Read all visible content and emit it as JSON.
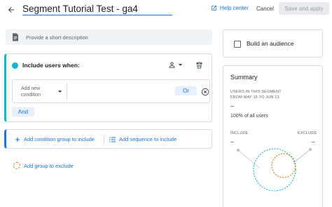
{
  "header": {
    "title": "Segment Tutorial Test - ga4",
    "help_label": "Help center",
    "cancel_label": "Cancel",
    "save_label": "Save and apply"
  },
  "description": {
    "placeholder": "Provide a short description"
  },
  "include_group": {
    "label": "Include users when:",
    "condition": {
      "select_label": "Add new condition",
      "or_label": "Or"
    },
    "and_label": "And"
  },
  "add_actions": {
    "condition_group_label": "Add condition group to include",
    "sequence_label": "Add sequence to include"
  },
  "exclude": {
    "label": "Add group to exclude"
  },
  "audience": {
    "label": "Build an audience",
    "checked": false
  },
  "summary": {
    "title": "Summary",
    "users_caption": "USERS IN THIS SEGMENT",
    "date_range": "FROM MAY 15 TO JUN 13",
    "user_count": "–",
    "percent_label": "100% of all users",
    "include_label": "INCLUDE",
    "exclude_label": "EXCLUDE",
    "include_value": "–",
    "exclude_value": "–"
  },
  "colors": {
    "accent": "#1a73e8",
    "include": "#12b5cb",
    "exclude": "#e8710a"
  },
  "icons": {
    "back": "arrow-left-icon",
    "help": "external-link-icon",
    "description": "document-icon",
    "scope": "person-icon",
    "delete": "trash-icon",
    "remove": "close-circle-icon",
    "add": "plus-icon",
    "sequence": "list-icon"
  }
}
